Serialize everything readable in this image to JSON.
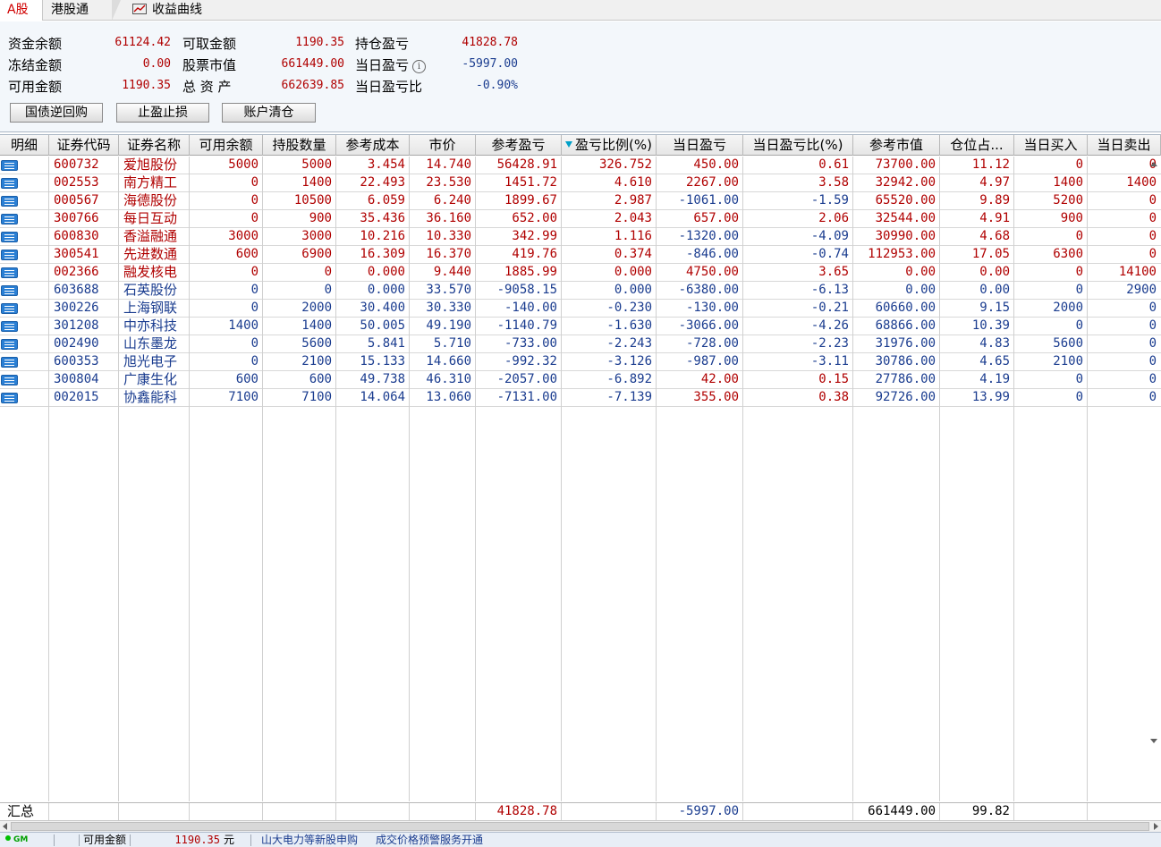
{
  "tabs": [
    {
      "label": "A股",
      "active": true
    },
    {
      "label": "港股通",
      "active": false
    },
    {
      "label": "收益曲线",
      "active": false
    }
  ],
  "summary": {
    "funds_balance": {
      "label": "资金余额",
      "value": "61124.42"
    },
    "frozen": {
      "label": "冻结金额",
      "value": "0.00"
    },
    "available": {
      "label": "可用金额",
      "value": "1190.35"
    },
    "withdrawable": {
      "label": "可取金额",
      "value": "1190.35"
    },
    "stock_value": {
      "label": "股票市值",
      "value": "661449.00"
    },
    "total_assets": {
      "label": "总 资 产",
      "value": "662639.85"
    },
    "position_pnl": {
      "label": "持仓盈亏",
      "value": "41828.78"
    },
    "today_pnl": {
      "label": "当日盈亏",
      "value": "-5997.00"
    },
    "today_pnl_ratio": {
      "label": "当日盈亏比",
      "value": "-0.90%"
    }
  },
  "buttons": {
    "repo": "国债逆回购",
    "stop": "止盈止损",
    "clear": "账户清仓"
  },
  "table": {
    "headers": [
      "明细",
      "证券代码",
      "证券名称",
      "可用余额",
      "持股数量",
      "参考成本",
      "市价",
      "参考盈亏",
      "盈亏比例(%)",
      "当日盈亏",
      "当日盈亏比(%)",
      "参考市值",
      "仓位占...",
      "当日买入",
      "当日卖出"
    ],
    "rows": [
      [
        "600732",
        "爱旭股份",
        "5000",
        "5000",
        "3.454",
        "14.740",
        "56428.91",
        "326.752",
        "450.00",
        "0.61",
        "73700.00",
        "11.12",
        "0",
        "0"
      ],
      [
        "002553",
        "南方精工",
        "0",
        "1400",
        "22.493",
        "23.530",
        "1451.72",
        "4.610",
        "2267.00",
        "3.58",
        "32942.00",
        "4.97",
        "1400",
        "1400"
      ],
      [
        "000567",
        "海德股份",
        "0",
        "10500",
        "6.059",
        "6.240",
        "1899.67",
        "2.987",
        "-1061.00",
        "-1.59",
        "65520.00",
        "9.89",
        "5200",
        "0"
      ],
      [
        "300766",
        "每日互动",
        "0",
        "900",
        "35.436",
        "36.160",
        "652.00",
        "2.043",
        "657.00",
        "2.06",
        "32544.00",
        "4.91",
        "900",
        "0"
      ],
      [
        "600830",
        "香溢融通",
        "3000",
        "3000",
        "10.216",
        "10.330",
        "342.99",
        "1.116",
        "-1320.00",
        "-4.09",
        "30990.00",
        "4.68",
        "0",
        "0"
      ],
      [
        "300541",
        "先进数通",
        "600",
        "6900",
        "16.309",
        "16.370",
        "419.76",
        "0.374",
        "-846.00",
        "-0.74",
        "112953.00",
        "17.05",
        "6300",
        "0"
      ],
      [
        "002366",
        "融发核电",
        "0",
        "0",
        "0.000",
        "9.440",
        "1885.99",
        "0.000",
        "4750.00",
        "3.65",
        "0.00",
        "0.00",
        "0",
        "14100"
      ],
      [
        "603688",
        "石英股份",
        "0",
        "0",
        "0.000",
        "33.570",
        "-9058.15",
        "0.000",
        "-6380.00",
        "-6.13",
        "0.00",
        "0.00",
        "0",
        "2900"
      ],
      [
        "300226",
        "上海钢联",
        "0",
        "2000",
        "30.400",
        "30.330",
        "-140.00",
        "-0.230",
        "-130.00",
        "-0.21",
        "60660.00",
        "9.15",
        "2000",
        "0"
      ],
      [
        "301208",
        "中亦科技",
        "1400",
        "1400",
        "50.005",
        "49.190",
        "-1140.79",
        "-1.630",
        "-3066.00",
        "-4.26",
        "68866.00",
        "10.39",
        "0",
        "0"
      ],
      [
        "002490",
        "山东墨龙",
        "0",
        "5600",
        "5.841",
        "5.710",
        "-733.00",
        "-2.243",
        "-728.00",
        "-2.23",
        "31976.00",
        "4.83",
        "5600",
        "0"
      ],
      [
        "600353",
        "旭光电子",
        "0",
        "2100",
        "15.133",
        "14.660",
        "-992.32",
        "-3.126",
        "-987.00",
        "-3.11",
        "30786.00",
        "4.65",
        "2100",
        "0"
      ],
      [
        "300804",
        "广康生化",
        "600",
        "600",
        "49.738",
        "46.310",
        "-2057.00",
        "-6.892",
        "42.00",
        "0.15",
        "27786.00",
        "4.19",
        "0",
        "0"
      ],
      [
        "002015",
        "协鑫能科",
        "7100",
        "7100",
        "14.064",
        "13.060",
        "-7131.00",
        "-7.139",
        "355.00",
        "0.38",
        "92726.00",
        "13.99",
        "0",
        "0"
      ]
    ],
    "total": {
      "label": "汇总",
      "ref_pnl": "41828.78",
      "today_pnl": "-5997.00",
      "market_value": "661449.00",
      "position_ratio": "99.82"
    }
  },
  "statusbar": {
    "gm": "GM",
    "available_label": "可用金额",
    "available_value": "1190.35",
    "unit": "元",
    "ipo_notice": "山大电力等新股申购",
    "price_alert": "成交价格预警服务开通"
  },
  "colors": {
    "positive": "#b00000",
    "negative": "#1a3c8f",
    "accent": "#2a7fd4"
  }
}
